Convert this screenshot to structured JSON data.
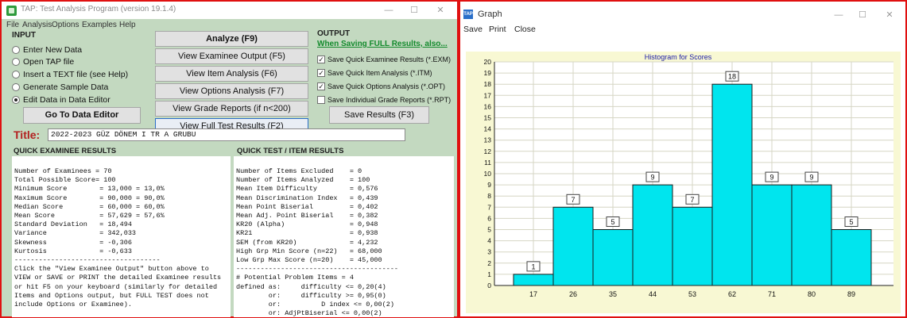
{
  "tap": {
    "window_title": "TAP: Test Analysis Program (version 19.1.4)",
    "menu": [
      "File",
      "Analysis",
      "Options",
      "Examples",
      "Help"
    ],
    "input": {
      "heading": "INPUT",
      "options": [
        {
          "label": "Enter New Data",
          "selected": false
        },
        {
          "label": "Open TAP file",
          "selected": false
        },
        {
          "label": "Insert a TEXT file (see Help)",
          "selected": false
        },
        {
          "label": "Generate Sample Data",
          "selected": false
        },
        {
          "label": "Edit Data in Data Editor",
          "selected": true
        }
      ],
      "go_button": "Go To Data Editor"
    },
    "center_buttons": [
      "Analyze (F9)",
      "View Examinee Output (F5)",
      "View Item Analysis (F6)",
      "View Options Analysis (F7)",
      "View Grade Reports (if n<200)",
      "View Full Test Results (F2)"
    ],
    "output": {
      "heading": "OUTPUT",
      "link": "When Saving FULL Results, also...",
      "checks": [
        {
          "label": "Save Quick Examinee Results (*.EXM)",
          "checked": true
        },
        {
          "label": "Save Quick Item Analysis (*.ITM)",
          "checked": true
        },
        {
          "label": "Save Quick Options Analysis (*.OPT)",
          "checked": true
        },
        {
          "label": "Save Individual Grade Reports (*.RPT)",
          "checked": false
        }
      ],
      "save_button": "Save Results (F3)"
    },
    "title_label": "Title:",
    "title_value": "2022-2023 GÜZ DÖNEM I TR A GRUBU",
    "quick_examinee_heading": "QUICK EXAMINEE RESULTS",
    "quick_examinee_text": "Number of Examinees = 70\nTotal Possible Score= 100\nMinimum Score        = 13,000 = 13,0%\nMaximum Score        = 90,000 = 90,0%\nMedian Score         = 60,000 = 60,0%\nMean Score           = 57,629 = 57,6%\nStandard Deviation   = 18,494\nVariance             = 342,033\nSkewness             = -0,306\nKurtosis             = -0,633\n------------------------------------\nClick the \"View Examinee Output\" button above to\nVIEW or SAVE or PRINT the detailed Examinee results\nor hit F5 on your keyboard (similarly for detailed\nItems and Options output, but FULL TEST does not\ninclude Options or Examinee).",
    "quick_test_heading": "QUICK TEST / ITEM RESULTS",
    "quick_test_text": "Number of Items Excluded    = 0\nNumber of Items Analyzed    = 100\nMean Item Difficulty        = 0,576\nMean Discrimination Index   = 0,439\nMean Point Biserial         = 0,402\nMean Adj. Point Biserial    = 0,382\nKR20 (Alpha)                = 0,948\nKR21                        = 0,938\nSEM (from KR20)             = 4,232\nHigh Grp Min Score (n=22)   = 68,000\nLow Grp Max Score (n=20)    = 45,000\n----------------------------------------\n# Potential Problem Items = 4\ndefined as:     difficulty <= 0,20(4)\n        or:     difficulty >= 0,95(0)\n        or:          D index <= 0,00(2)\n        or: AdjPtBiserial <= 0,00(2)"
  },
  "graph": {
    "window_title": "Graph",
    "menu": [
      "Save",
      "Print",
      "Close"
    ],
    "chart_data": {
      "type": "bar",
      "title": "Histogram for Scores",
      "categories": [
        "17",
        "26",
        "35",
        "44",
        "53",
        "62",
        "71",
        "80",
        "89"
      ],
      "values": [
        1,
        7,
        5,
        9,
        7,
        18,
        9,
        9,
        5
      ],
      "ylim": [
        0,
        20
      ],
      "yticks": [
        "0",
        "1",
        "2",
        "3",
        "4",
        "5",
        "6",
        "7",
        "8",
        "9",
        "10",
        "11",
        "12",
        "13",
        "14",
        "15",
        "16",
        "17",
        "18",
        "19",
        "20"
      ],
      "grid": true,
      "xlabel": "",
      "ylabel": "",
      "bar_color": "#00e5ee",
      "background_color": "#f8f8d3"
    }
  }
}
